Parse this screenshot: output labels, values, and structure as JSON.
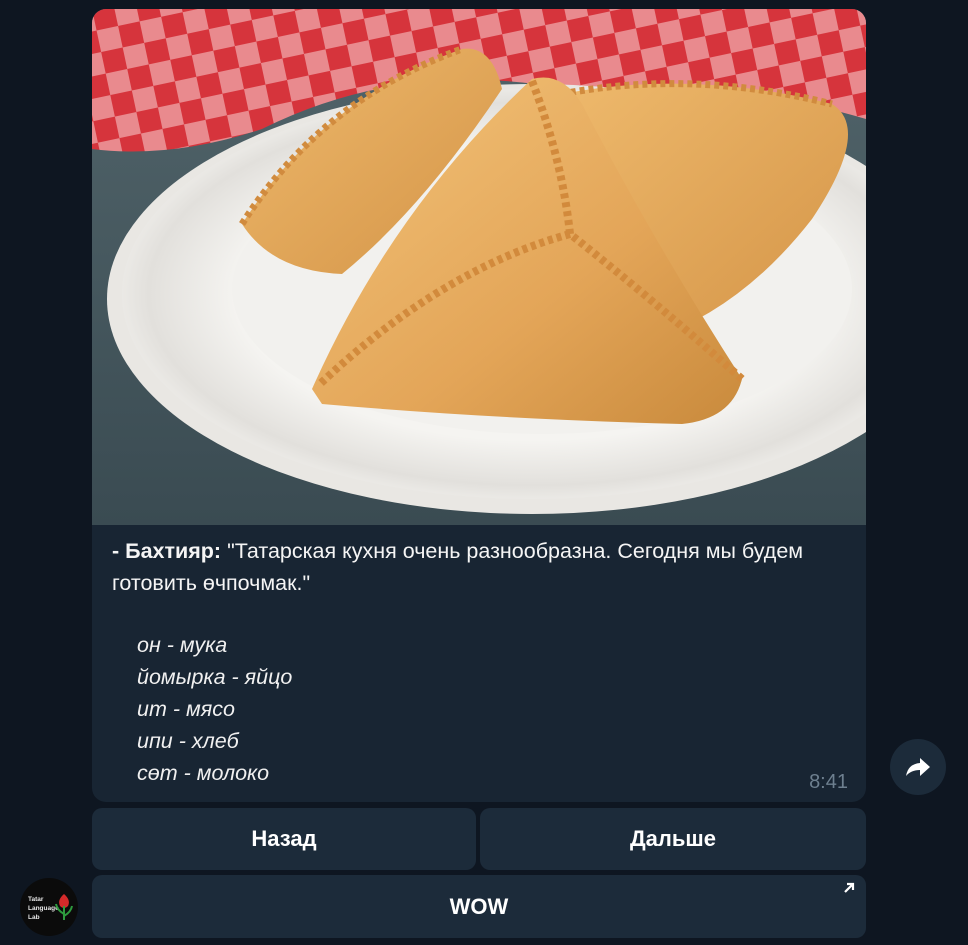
{
  "message": {
    "speaker": "- Бахтияр:",
    "text": " \"Татарская кухня очень разнообразна. Сегодня мы будем готовить өчпочмак.\"",
    "vocab": [
      "он - мука",
      "йомырка - яйцо",
      "ит - мясо",
      "ипи - хлеб",
      "сөт - молоко"
    ],
    "time": "8:41"
  },
  "keyboard": {
    "back_label": "Назад",
    "next_label": "Дальше",
    "wow_label": "WOW"
  },
  "avatar": {
    "lines": [
      "Tatar",
      "Language",
      "Lab"
    ]
  },
  "icons": {
    "share": "share-arrow-icon",
    "link": "external-link-arrow-icon"
  },
  "colors": {
    "background": "#0e1621",
    "bubble": "#182533",
    "button": "#1c2b3a",
    "timestamp": "#6d7f8f"
  }
}
